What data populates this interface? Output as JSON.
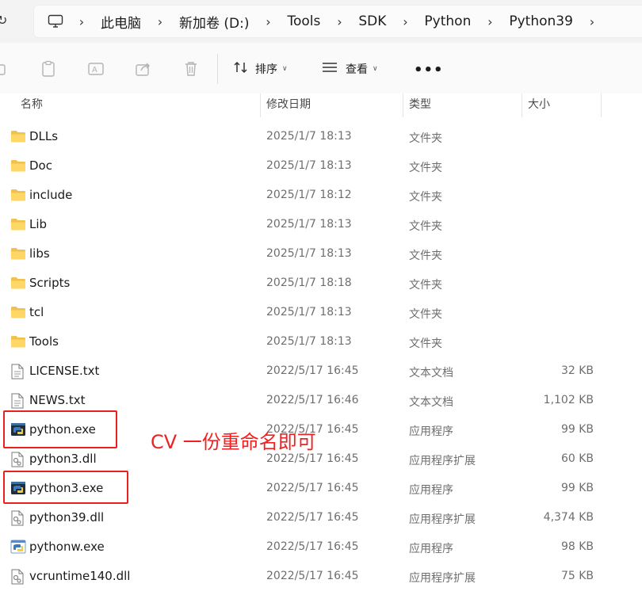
{
  "address": {
    "refresh_icon": "refresh-icon",
    "pc_icon": "computer-icon",
    "crumbs": [
      "此电脑",
      "新加卷 (D:)",
      "Tools",
      "SDK",
      "Python",
      "Python39"
    ]
  },
  "toolbar": {
    "sort_label": "排序",
    "view_label": "查看",
    "more_label": "•••"
  },
  "columns": {
    "name": "名称",
    "modified": "修改日期",
    "type": "类型",
    "size": "大小"
  },
  "files": [
    {
      "name": "DLLs",
      "date": "2025/1/7 18:13",
      "type": "文件夹",
      "size": "",
      "icon": "folder-icon"
    },
    {
      "name": "Doc",
      "date": "2025/1/7 18:13",
      "type": "文件夹",
      "size": "",
      "icon": "folder-icon"
    },
    {
      "name": "include",
      "date": "2025/1/7 18:12",
      "type": "文件夹",
      "size": "",
      "icon": "folder-icon"
    },
    {
      "name": "Lib",
      "date": "2025/1/7 18:13",
      "type": "文件夹",
      "size": "",
      "icon": "folder-icon"
    },
    {
      "name": "libs",
      "date": "2025/1/7 18:13",
      "type": "文件夹",
      "size": "",
      "icon": "folder-icon"
    },
    {
      "name": "Scripts",
      "date": "2025/1/7 18:18",
      "type": "文件夹",
      "size": "",
      "icon": "folder-icon"
    },
    {
      "name": "tcl",
      "date": "2025/1/7 18:13",
      "type": "文件夹",
      "size": "",
      "icon": "folder-icon"
    },
    {
      "name": "Tools",
      "date": "2025/1/7 18:13",
      "type": "文件夹",
      "size": "",
      "icon": "folder-icon"
    },
    {
      "name": "LICENSE.txt",
      "date": "2022/5/17 16:45",
      "type": "文本文档",
      "size": "32 KB",
      "icon": "text-file-icon"
    },
    {
      "name": "NEWS.txt",
      "date": "2022/5/17 16:46",
      "type": "文本文档",
      "size": "1,102 KB",
      "icon": "text-file-icon"
    },
    {
      "name": "python.exe",
      "date": "2022/5/17 16:45",
      "type": "应用程序",
      "size": "99 KB",
      "icon": "python-exe-icon"
    },
    {
      "name": "python3.dll",
      "date": "2022/5/17 16:45",
      "type": "应用程序扩展",
      "size": "60 KB",
      "icon": "dll-file-icon"
    },
    {
      "name": "python3.exe",
      "date": "2022/5/17 16:45",
      "type": "应用程序",
      "size": "99 KB",
      "icon": "python-exe-icon"
    },
    {
      "name": "python39.dll",
      "date": "2022/5/17 16:45",
      "type": "应用程序扩展",
      "size": "4,374 KB",
      "icon": "dll-file-icon"
    },
    {
      "name": "pythonw.exe",
      "date": "2022/5/17 16:45",
      "type": "应用程序",
      "size": "98 KB",
      "icon": "pythonw-exe-icon"
    },
    {
      "name": "vcruntime140.dll",
      "date": "2022/5/17 16:45",
      "type": "应用程序扩展",
      "size": "75 KB",
      "icon": "dll-file-icon"
    }
  ],
  "annotation": {
    "text": "CV 一份重命名即可",
    "color": "#e8211f"
  }
}
